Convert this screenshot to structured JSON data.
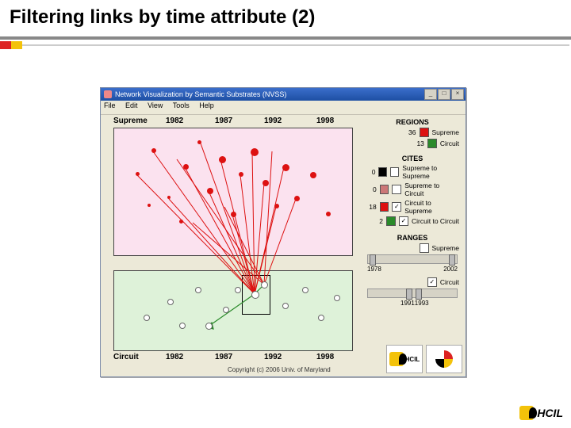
{
  "slide": {
    "title": "Filtering links by time attribute (2)"
  },
  "window": {
    "title": "Network Visualization by Semantic Substrates (NVSS)",
    "menu": [
      "File",
      "Edit",
      "View",
      "Tools",
      "Help"
    ],
    "win_btn_min": "_",
    "win_btn_max": "□",
    "win_btn_close": "×"
  },
  "plot": {
    "top_label": "Supreme",
    "bot_label": "Circuit",
    "ticks": [
      "1982",
      "1987",
      "1992",
      "1998"
    ]
  },
  "side": {
    "regions_h": "REGIONS",
    "regions": [
      {
        "n": "36",
        "color": "#d11",
        "label": "Supreme"
      },
      {
        "n": "13",
        "color": "#2a8a2a",
        "label": "Circuit"
      }
    ],
    "cites_h": "CITES",
    "cites": [
      {
        "n": "0",
        "color": "#000",
        "checked": false,
        "label": "Supreme to Supreme"
      },
      {
        "n": "0",
        "color": "#c77",
        "checked": false,
        "label": "Supreme to Circuit"
      },
      {
        "n": "18",
        "color": "#d11",
        "checked": true,
        "label": "Circuit to Supreme"
      },
      {
        "n": "2",
        "color": "#2a8a2a",
        "checked": true,
        "label": "Circuit to Circuit"
      }
    ],
    "ranges_h": "RANGES",
    "range1": {
      "label": "Supreme",
      "checked": false,
      "from": "1978",
      "to": "2002"
    },
    "range2": {
      "label": "Circuit",
      "checked": true,
      "from": "1991",
      "to": "1993"
    }
  },
  "footer": {
    "copyright": "Copyright (c) 2006  Univ. of Maryland",
    "hcil": "HCIL"
  },
  "corner": {
    "hcil": "HCIL"
  }
}
